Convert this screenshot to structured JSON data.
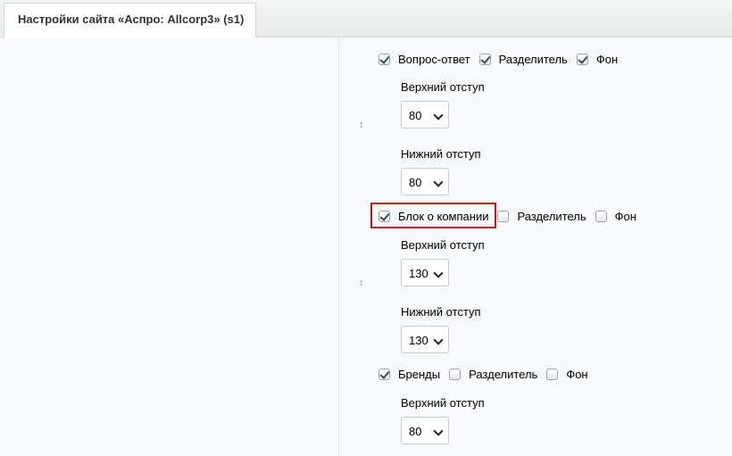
{
  "tab": {
    "title": "Настройки сайта «Аспро: Allcorp3» (s1)"
  },
  "icons": {
    "updown": "↕"
  },
  "blocks": [
    {
      "name": "Вопрос-ответ",
      "checked": true,
      "divider_label": "Разделитель",
      "divider_checked": true,
      "bg_label": "Фон",
      "bg_checked": true,
      "top_label": "Верхний отступ",
      "top_value": "80",
      "bottom_label": "Нижний отступ",
      "bottom_value": "80"
    },
    {
      "name": "Блок о компании",
      "checked": true,
      "divider_label": "Разделитель",
      "divider_checked": false,
      "bg_label": "Фон",
      "bg_checked": false,
      "top_label": "Верхний отступ",
      "top_value": "130",
      "bottom_label": "Нижний отступ",
      "bottom_value": "130"
    },
    {
      "name": "Бренды",
      "checked": true,
      "divider_label": "Разделитель",
      "divider_checked": false,
      "bg_label": "Фон",
      "bg_checked": false,
      "top_label": "Верхний отступ",
      "top_value": "80"
    }
  ],
  "highlight_color": "#b3171b"
}
